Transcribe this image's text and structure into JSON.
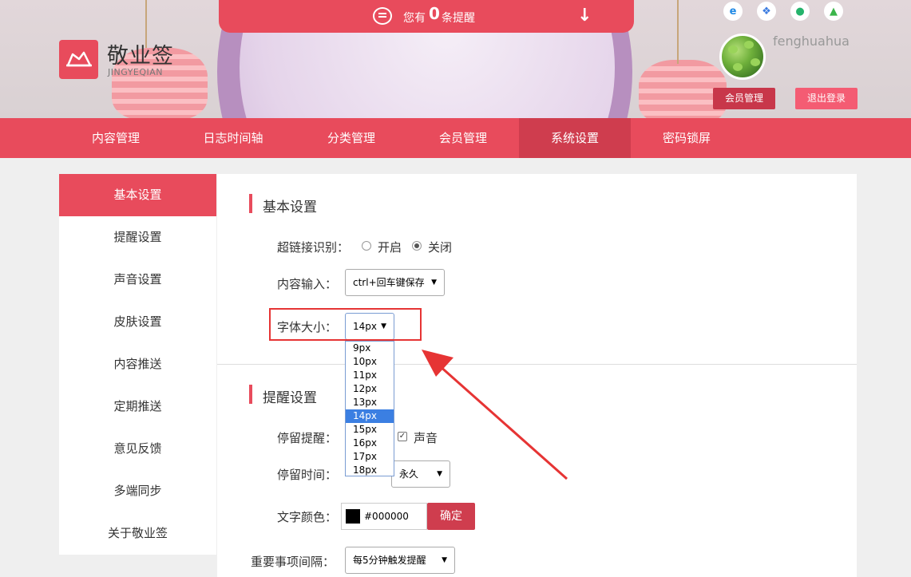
{
  "header": {
    "brand": "敬业签",
    "brand_sub": "JINGYEQIAN",
    "notice": {
      "prefix": "您有",
      "count": "0",
      "suffix": "条提醒",
      "arrow": "↓"
    },
    "platforms": [
      {
        "name": "ie-icon",
        "glyph": "e",
        "color": "#1e88e5"
      },
      {
        "name": "windows-icon",
        "glyph": "❖",
        "color": "#3b7be0"
      },
      {
        "name": "apple-icon",
        "glyph": "●",
        "color": "#25b36b"
      },
      {
        "name": "android-icon",
        "glyph": "▲",
        "color": "#3bb54a"
      }
    ],
    "username": "fenghuahua",
    "member_btn": "会员管理",
    "logout_btn": "退出登录"
  },
  "nav": {
    "items": [
      "内容管理",
      "日志时间轴",
      "分类管理",
      "会员管理",
      "系统设置",
      "密码锁屏"
    ],
    "active_index": 4
  },
  "sidebar": {
    "items": [
      "基本设置",
      "提醒设置",
      "声音设置",
      "皮肤设置",
      "内容推送",
      "定期推送",
      "意见反馈",
      "多端同步",
      "关于敬业签"
    ],
    "active_index": 0
  },
  "basic": {
    "title": "基本设置",
    "link_label": "超链接识别：",
    "link_on": "开启",
    "link_off": "关闭",
    "link_selected": "关闭",
    "input_label": "内容输入：",
    "input_value": "ctrl+回车键保存",
    "font_label": "字体大小：",
    "font_value": "14px",
    "font_options": [
      "9px",
      "10px",
      "11px",
      "12px",
      "13px",
      "14px",
      "15px",
      "16px",
      "17px",
      "18px"
    ]
  },
  "remind": {
    "title": "提醒设置",
    "stay_label": "停留提醒：",
    "stay_sound": "声音",
    "stay_sound_checked": true,
    "time_label": "停留时间：",
    "time_value": "永久",
    "color_label": "文字颜色：",
    "color_value": "#000000",
    "ok_btn": "确定",
    "interval_label": "重要事项间隔：",
    "interval_value": "每5分钟触发提醒"
  },
  "colors": {
    "accent": "#e84b5c",
    "accent_dark": "#cf3d4e",
    "annotation": "#e63434"
  }
}
